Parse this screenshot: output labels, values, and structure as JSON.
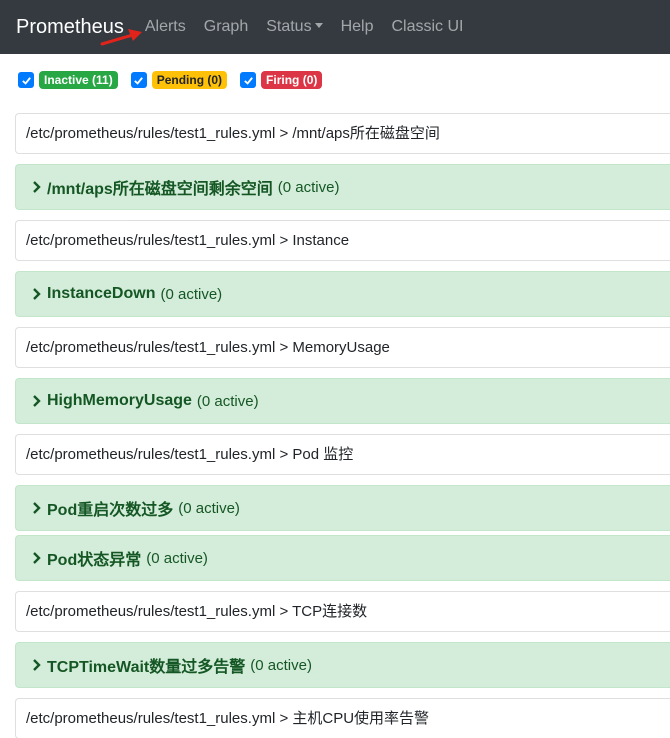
{
  "navbar": {
    "brand": "Prometheus",
    "links": [
      "Alerts",
      "Graph",
      "Status",
      "Help",
      "Classic UI"
    ]
  },
  "filters": [
    {
      "label": "Inactive (11)",
      "variant": "success",
      "checked": true
    },
    {
      "label": "Pending (0)",
      "variant": "warning",
      "checked": true
    },
    {
      "label": "Firing (0)",
      "variant": "danger",
      "checked": true
    }
  ],
  "groups": [
    {
      "file": "/etc/prometheus/rules/test1_rules.yml > /mnt/aps所在磁盘空间",
      "rules": [
        {
          "name": "/mnt/aps所在磁盘空间剩余空间",
          "count": "(0 active)"
        }
      ]
    },
    {
      "file": "/etc/prometheus/rules/test1_rules.yml > Instance",
      "rules": [
        {
          "name": "InstanceDown",
          "count": "(0 active)"
        }
      ]
    },
    {
      "file": "/etc/prometheus/rules/test1_rules.yml > MemoryUsage",
      "rules": [
        {
          "name": "HighMemoryUsage",
          "count": "(0 active)"
        }
      ]
    },
    {
      "file": "/etc/prometheus/rules/test1_rules.yml > Pod 监控",
      "rules": [
        {
          "name": "Pod重启次数过多",
          "count": "(0 active)"
        },
        {
          "name": "Pod状态异常",
          "count": "(0 active)"
        }
      ]
    },
    {
      "file": "/etc/prometheus/rules/test1_rules.yml > TCP连接数",
      "rules": [
        {
          "name": "TCPTimeWait数量过多告警",
          "count": "(0 active)"
        }
      ]
    },
    {
      "file": "/etc/prometheus/rules/test1_rules.yml > 主机CPU使用率告警",
      "rules": []
    }
  ]
}
